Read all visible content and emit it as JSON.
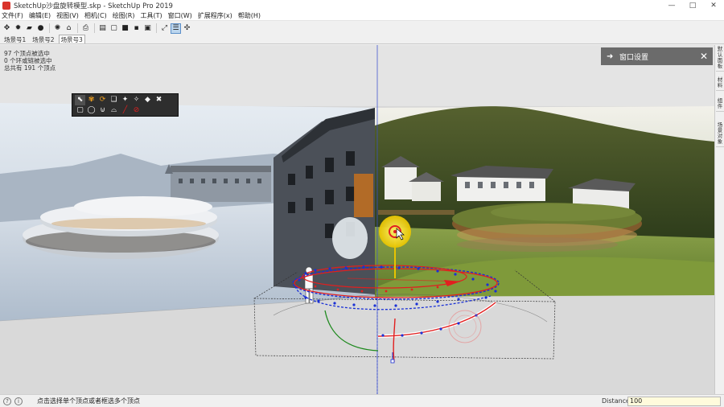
{
  "window": {
    "title": "SketchUp沙盘旋转模型.skp - SketchUp Pro 2019",
    "controls": [
      "—",
      "□",
      "✕"
    ]
  },
  "menu": [
    "文件(F)",
    "编辑(E)",
    "视图(V)",
    "相机(C)",
    "绘图(R)",
    "工具(T)",
    "窗口(W)",
    "扩展程序(x)",
    "帮助(H)"
  ],
  "toolbar": {
    "groups": [
      [
        {
          "name": "select-tool",
          "glyph": "✥"
        },
        {
          "name": "gear-tool",
          "glyph": "✹"
        },
        {
          "name": "folder",
          "glyph": "▰"
        },
        {
          "name": "record",
          "glyph": "●"
        }
      ],
      [
        {
          "name": "sun-tool",
          "glyph": "✺"
        },
        {
          "name": "warehouse",
          "glyph": "⌂"
        }
      ],
      [
        {
          "name": "print",
          "glyph": "⎙"
        }
      ],
      [
        {
          "name": "shadow-1",
          "glyph": "▤"
        },
        {
          "name": "shadow-2",
          "glyph": "▢"
        },
        {
          "name": "shadow-3",
          "glyph": "■"
        },
        {
          "name": "shadow-4",
          "glyph": "▪"
        },
        {
          "name": "shadow-5",
          "glyph": "▣"
        }
      ],
      [
        {
          "name": "expand",
          "glyph": "⤢"
        },
        {
          "name": "outliner",
          "glyph": "☰"
        },
        {
          "name": "move-gizmo",
          "glyph": "✣"
        }
      ]
    ],
    "active": [
      "outliner"
    ]
  },
  "scenes": [
    {
      "label": "场景号1",
      "active": false
    },
    {
      "label": "场景号2",
      "active": false
    },
    {
      "label": "场景号3",
      "active": true
    }
  ],
  "viewport": {
    "info_lines": [
      "97 个顶点被选中",
      "0 个环或链被选中",
      "总共有 191 个顶点"
    ]
  },
  "float_tools": [
    {
      "name": "select",
      "glyph": "⬉"
    },
    {
      "name": "spiral",
      "glyph": "✾"
    },
    {
      "name": "rotate",
      "glyph": "⟳"
    },
    {
      "name": "paste",
      "glyph": "❏"
    },
    {
      "name": "wand",
      "glyph": "✦"
    },
    {
      "name": "wand2",
      "glyph": "✧"
    },
    {
      "name": "eraser",
      "glyph": "◆"
    },
    {
      "name": "close",
      "glyph": "✖"
    },
    {
      "name": "box",
      "glyph": "▢"
    },
    {
      "name": "circle",
      "glyph": "◯"
    },
    {
      "name": "lasso",
      "glyph": "⊍"
    },
    {
      "name": "freehand",
      "glyph": "⌓"
    },
    {
      "name": "line",
      "glyph": "╱"
    },
    {
      "name": "line-box",
      "glyph": "⊘"
    }
  ],
  "tray": {
    "title": "窗口设置"
  },
  "right_strip": [
    "默认面板",
    "材料",
    "组件",
    "场景对象"
  ],
  "status": {
    "hint": "点击选择单个顶点或者框选多个顶点",
    "measurement_label": "Distance",
    "measurement_value": "100"
  },
  "colors": {
    "accent": "#5b8fc9",
    "tray": "#6b6b6b",
    "floating_toolbar": "#2e2e2e",
    "spiral_red": "#e11f1f",
    "vertex_blue": "#1a30d6",
    "axis_green": "#1f8a1f"
  }
}
